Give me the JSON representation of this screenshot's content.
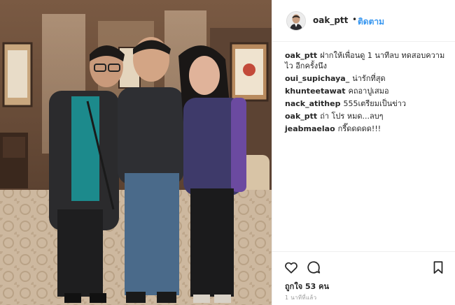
{
  "post": {
    "username": "oak_ptt",
    "separator": "•",
    "follow_label": "ติดตาม",
    "likes": "ถูกใจ 53 คน",
    "timestamp": "1 นาทีที่แล้ว"
  },
  "comments": [
    {
      "user": "oak_ptt",
      "text": "ฝากให้เพื่อนดู 1 นาทีลบ ทดสอบความไว อีกครั้งนึง"
    },
    {
      "user": "oui_supichaya_",
      "text": "น่ารักที่สุด"
    },
    {
      "user": "khunteetawat",
      "text": "คถอาปูเสมอ"
    },
    {
      "user": "nack_atithep",
      "text": "555เตรียมเป็นข่าว"
    },
    {
      "user": "oak_ptt",
      "text": "ถ่า โปร หมด...ลบๆ"
    },
    {
      "user": "jeabmaelao",
      "text": "กรี๊ดดดดด!!!"
    }
  ],
  "icons": {
    "like": "heart-icon",
    "comment": "speech-bubble-icon",
    "save": "bookmark-icon"
  },
  "colors": {
    "follow": "#3897f0",
    "text": "#262626",
    "muted": "#999999",
    "divider": "#efefef"
  }
}
